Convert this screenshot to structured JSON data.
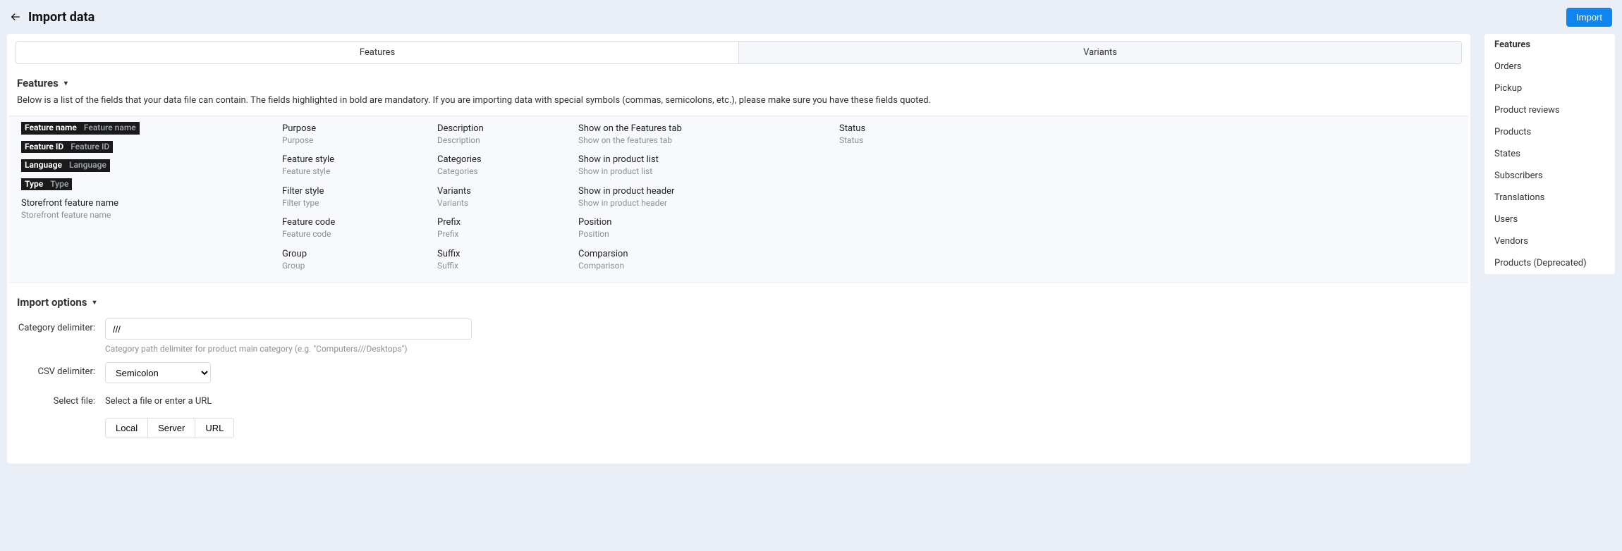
{
  "header": {
    "title": "Import data",
    "import_btn": "Import"
  },
  "tabs": {
    "features": "Features",
    "variants": "Variants"
  },
  "section": {
    "features_title": "Features",
    "import_opts_title": "Import options",
    "help": "Below is a list of the fields that your data file can contain. The fields highlighted in bold are mandatory. If you are importing data with special symbols (commas, semicolons, etc.), please make sure you have these fields quoted."
  },
  "fields": {
    "col1": [
      {
        "t": "Feature name",
        "b": "Feature name",
        "m": true
      },
      {
        "t": "Feature ID",
        "b": "Feature ID",
        "m": true
      },
      {
        "t": "Language",
        "b": "Language",
        "m": true
      },
      {
        "t": "Type",
        "b": "Type",
        "m": true
      },
      {
        "t": "Storefront feature name",
        "b": "Storefront feature name",
        "m": false
      }
    ],
    "col2": [
      {
        "t": "Purpose",
        "b": "Purpose"
      },
      {
        "t": "Feature style",
        "b": "Feature style"
      },
      {
        "t": "Filter style",
        "b": "Filter type"
      },
      {
        "t": "Feature code",
        "b": "Feature code"
      },
      {
        "t": "Group",
        "b": "Group"
      }
    ],
    "col3": [
      {
        "t": "Description",
        "b": "Description"
      },
      {
        "t": "Categories",
        "b": "Categories"
      },
      {
        "t": "Variants",
        "b": "Variants"
      },
      {
        "t": "Prefix",
        "b": "Prefix"
      },
      {
        "t": "Suffix",
        "b": "Suffix"
      }
    ],
    "col4": [
      {
        "t": "Show on the Features tab",
        "b": "Show on the features tab"
      },
      {
        "t": "Show in product list",
        "b": "Show in product list"
      },
      {
        "t": "Show in product header",
        "b": "Show in product header"
      },
      {
        "t": "Position",
        "b": "Position"
      },
      {
        "t": "Comparsion",
        "b": "Comparison"
      }
    ],
    "col5": [
      {
        "t": "Status",
        "b": "Status"
      }
    ]
  },
  "opts": {
    "cat_delim_label": "Category delimiter:",
    "cat_delim_value": "///",
    "cat_delim_hint": "Category path delimiter for product main category (e.g. \"Computers///Desktops\")",
    "csv_delim_label": "CSV delimiter:",
    "csv_delim_value": "Semicolon",
    "select_file_label": "Select file:",
    "select_file_text": "Select a file or enter a URL",
    "btn_local": "Local",
    "btn_server": "Server",
    "btn_url": "URL"
  },
  "sidebar": [
    "Features",
    "Orders",
    "Pickup",
    "Product reviews",
    "Products",
    "States",
    "Subscribers",
    "Translations",
    "Users",
    "Vendors",
    "Products (Deprecated)"
  ]
}
